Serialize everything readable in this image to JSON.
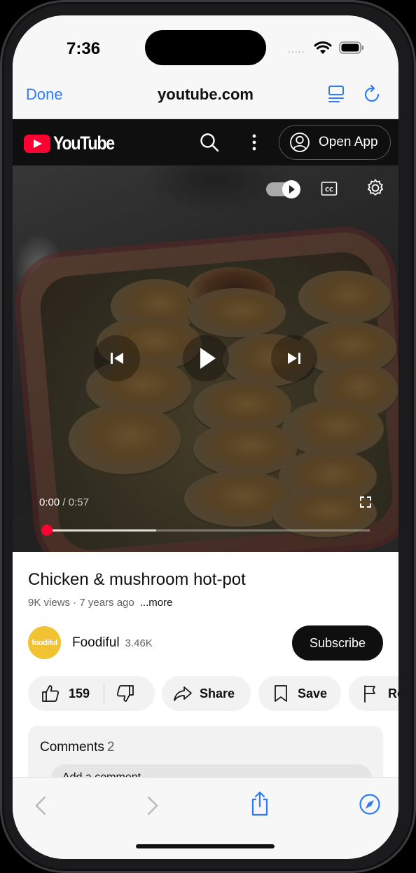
{
  "status_bar": {
    "time": "7:36",
    "signal": "....."
  },
  "safari": {
    "done_label": "Done",
    "url": "youtube.com"
  },
  "youtube": {
    "logo_text": "YouTube",
    "open_app_label": "Open App"
  },
  "player": {
    "current_time": "0:00",
    "separator": " / ",
    "duration": "0:57",
    "played_fraction": 0.0,
    "buffered_fraction": 0.34,
    "autoplay": "on"
  },
  "video": {
    "title": "Chicken & mushroom hot-pot",
    "meta": "9K views · 7 years ago",
    "more_label": "...more"
  },
  "channel": {
    "avatar_text": "foodiful",
    "name": "Foodiful",
    "subscribers": "3.46K",
    "subscribe_label": "Subscribe"
  },
  "actions": {
    "like_count": "159",
    "share_label": "Share",
    "save_label": "Save",
    "report_label": "Re"
  },
  "comments": {
    "title": "Comments",
    "count": "2",
    "add_placeholder": "Add a comment..."
  },
  "colors": {
    "safari_blue": "#2f7cf6",
    "youtube_red": "#ff0033",
    "subscribe_bg": "#0f0f0f"
  }
}
